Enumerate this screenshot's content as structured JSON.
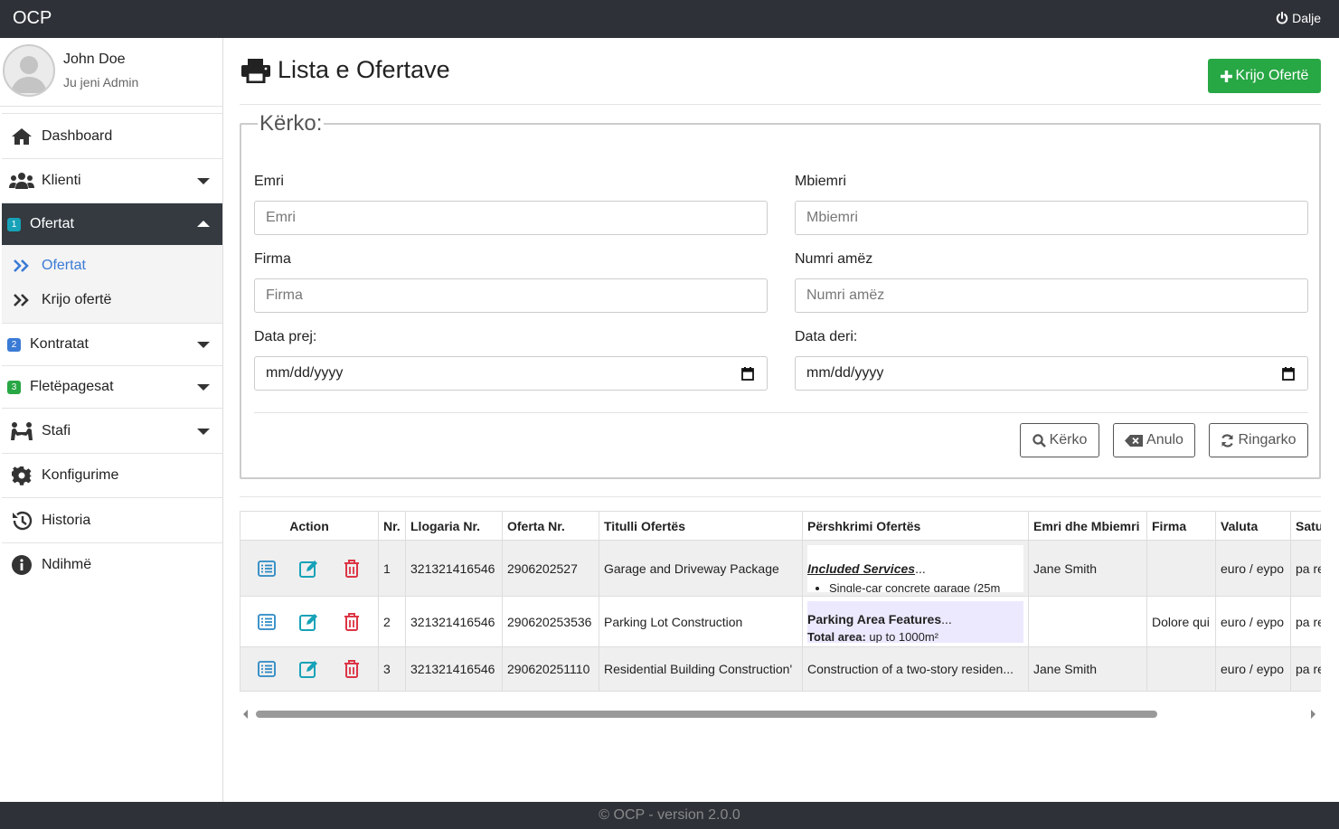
{
  "topbar": {
    "brand": "OCP",
    "logout_label": "Dalje"
  },
  "user": {
    "name": "John Doe",
    "role": "Ju jeni Admin"
  },
  "nav": {
    "dashboard": "Dashboard",
    "klienti": "Klienti",
    "ofertat": "Ofertat",
    "ofertat_badge": "1",
    "ofertat_sub": [
      "Ofertat",
      "Krijo ofertë"
    ],
    "kontratat": "Kontratat",
    "kontratat_badge": "2",
    "fletepagesat": "Fletëpagesat",
    "fletepagesat_badge": "3",
    "stafi": "Stafi",
    "konfigurime": "Konfigurime",
    "historia": "Historia",
    "ndihme": "Ndihmë"
  },
  "page": {
    "title": "Lista e Ofertave",
    "create_label": "Krijo Ofertë"
  },
  "search": {
    "legend": "Kërko:",
    "emri_label": "Emri",
    "emri_placeholder": "Emri",
    "mbiemri_label": "Mbiemri",
    "mbiemri_placeholder": "Mbiemri",
    "firma_label": "Firma",
    "firma_placeholder": "Firma",
    "numri_label": "Numri amëz",
    "numri_placeholder": "Numri amëz",
    "data_prej_label": "Data prej:",
    "data_prej_value": "mm/dd/yyyy",
    "data_deri_label": "Data deri:",
    "data_deri_value": "mm/dd/yyyy",
    "search_btn": "Kërko",
    "cancel_btn": "Anulo",
    "reload_btn": "Ringarko"
  },
  "table": {
    "headers": [
      "Action",
      "Nr.",
      "Llogaria Nr.",
      "Oferta Nr.",
      "Titulli Ofertës",
      "Përshkrimi Ofertës",
      "Emri dhe Mbiemri",
      "Firma",
      "Valuta",
      "Satu"
    ],
    "rows": [
      {
        "nr": "1",
        "llogaria": "321321416546",
        "oferta": "2906202527",
        "titulli": "Garage and Driveway Package",
        "desc_title": "Included Services",
        "desc_ellipsis": "...",
        "desc_item": "Single-car concrete garage (25m",
        "emri": "Jane Smith",
        "firma": "",
        "valuta": "euro / eypo",
        "statusi": "pa re"
      },
      {
        "nr": "2",
        "llogaria": "321321416546",
        "oferta": "290620253536",
        "titulli": "Parking Lot Construction",
        "desc_title": "Parking Area Features",
        "desc_ellipsis": "...",
        "desc_sub_bold": "Total area:",
        "desc_sub": " up to 1000m²",
        "emri": "",
        "firma": "Dolore qui",
        "valuta": "euro / eypo",
        "statusi": "pa re"
      },
      {
        "nr": "3",
        "llogaria": "321321416546",
        "oferta": "290620251110",
        "titulli": "Residential Building Construction'",
        "desc": "Construction of a two-story residen...",
        "emri": "Jane Smith",
        "firma": "",
        "valuta": "euro / eypo",
        "statusi": "pa re"
      }
    ]
  },
  "footer": {
    "text": "© OCP - version 2.0.0"
  },
  "colors": {
    "topbar": "#2e3238",
    "active_nav": "#343a40",
    "success": "#28a745",
    "link": "#3a7bd5",
    "view_icon": "#2a88c4",
    "edit_icon": "#17a2b8",
    "delete_icon": "#dc3545"
  }
}
